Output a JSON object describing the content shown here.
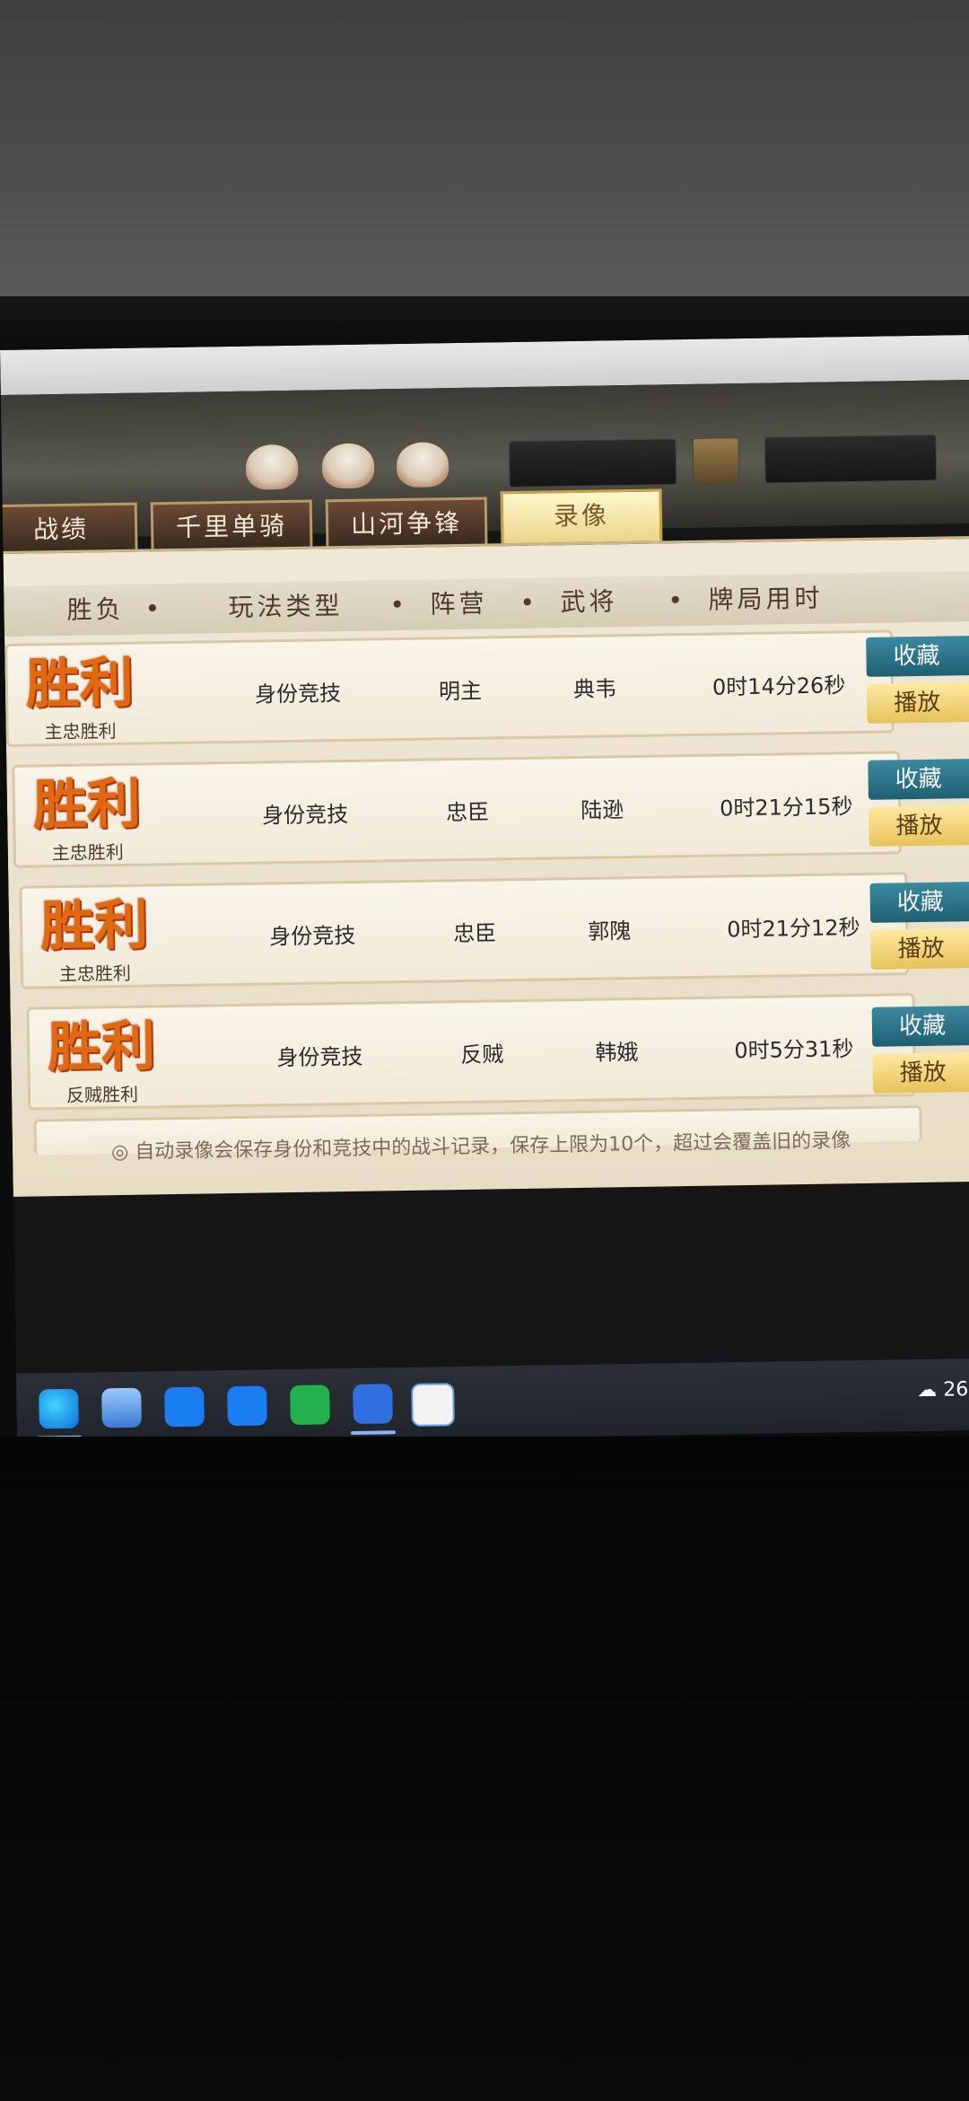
{
  "tabs": [
    {
      "label": "战绩",
      "active": false
    },
    {
      "label": "千里单骑",
      "active": false
    },
    {
      "label": "山河争锋",
      "active": false
    },
    {
      "label": "录像",
      "active": true
    }
  ],
  "columns": [
    "胜负",
    "玩法类型",
    "阵营",
    "武将",
    "牌局用时"
  ],
  "rows": [
    {
      "result": "胜利",
      "sub": "主忠胜利",
      "mode": "身份竞技",
      "camp": "明主",
      "general": "典韦",
      "duration": "0时14分26秒",
      "fav": "收藏",
      "play": "播放"
    },
    {
      "result": "胜利",
      "sub": "主忠胜利",
      "mode": "身份竞技",
      "camp": "忠臣",
      "general": "陆逊",
      "duration": "0时21分15秒",
      "fav": "收藏",
      "play": "播放"
    },
    {
      "result": "胜利",
      "sub": "主忠胜利",
      "mode": "身份竞技",
      "camp": "忠臣",
      "general": "郭隗",
      "duration": "0时21分12秒",
      "fav": "收藏",
      "play": "播放"
    },
    {
      "result": "胜利",
      "sub": "反贼胜利",
      "mode": "身份竞技",
      "camp": "反贼",
      "general": "韩娥",
      "duration": "0时5分31秒",
      "fav": "收藏",
      "play": "播放"
    }
  ],
  "note": "自动录像会保存身份和竞技中的战斗记录，保存上限为10个，超过会覆盖旧的录像",
  "taskbar": {
    "icons": [
      "edge-icon",
      "computer-icon",
      "tencent-icon",
      "tencent-icon-2",
      "wechat-icon",
      "xbox-icon",
      "game-icon"
    ],
    "weather": "26°"
  },
  "colors": {
    "accent_teal": "#1f5f72",
    "accent_gold": "#e6c25a",
    "victory_orange": "#e06a12"
  }
}
